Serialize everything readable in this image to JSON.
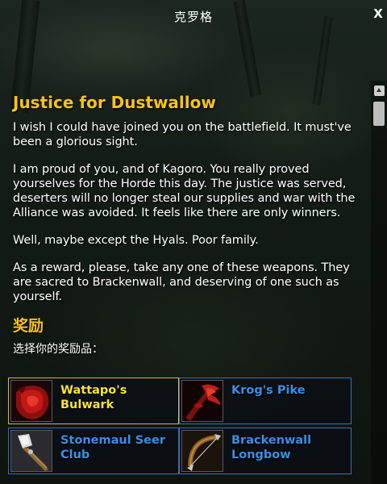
{
  "window": {
    "title": "克罗格",
    "close_label": "X"
  },
  "quest": {
    "title": "Justice for Dustwallow",
    "paragraphs": [
      "I wish I could have joined you on the battlefield. It must've been a glorious sight.",
      "I am proud of you, and of Kagoro. You really proved yourselves for the Horde this day. The justice was served, deserters will no longer steal our supplies and war with the Alliance was avoided. It feels like there are only winners.",
      "Well, maybe except the Hyals. Poor family.",
      "As a reward, please, take any one of these weapons. They are sacred to Brackenwall, and deserving of one such as yourself."
    ]
  },
  "rewards": {
    "heading": "奖励",
    "choose_label": "选择你的奖励品：",
    "items": [
      {
        "name": "Wattapo's Bulwark",
        "icon": "red-shield-icon",
        "selected": true
      },
      {
        "name": "Krog's Pike",
        "icon": "red-pike-icon",
        "selected": false
      },
      {
        "name": "Stonemaul Seer Club",
        "icon": "club-icon",
        "selected": false
      },
      {
        "name": "Brackenwall Longbow",
        "icon": "longbow-icon",
        "selected": false
      }
    ]
  },
  "colors": {
    "quest_title": "#f7c21c",
    "selected_item_text": "#f7e33a",
    "item_text": "#3c8ee6",
    "selected_border": "#d7b54a",
    "item_border": "#3a6fb5"
  }
}
